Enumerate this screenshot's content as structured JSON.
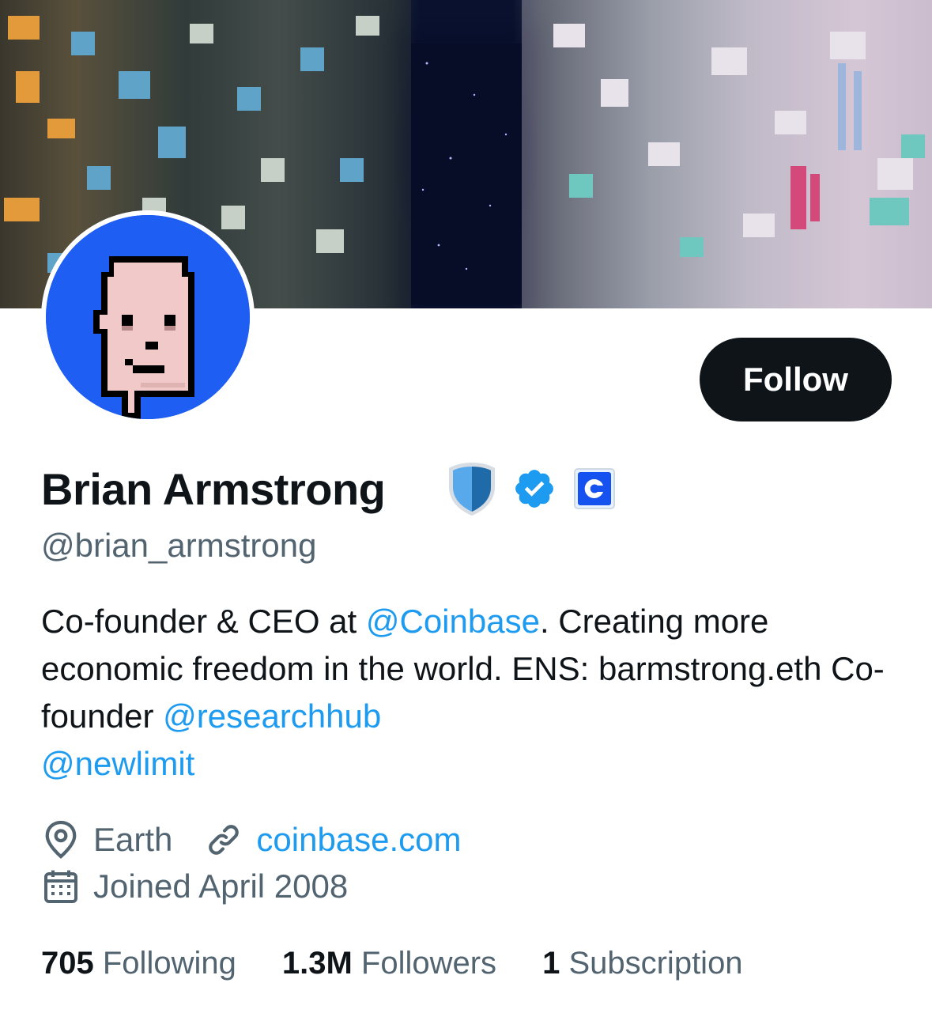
{
  "banner": {
    "description_icon": "city-courtyard-banner"
  },
  "profile": {
    "name": "Brian Armstrong",
    "handle": "@brian_armstrong",
    "follow_label": "Follow",
    "badges": [
      "shield-icon",
      "verified-badge-icon",
      "coinbase-affiliate-icon"
    ]
  },
  "bio": {
    "p1": "Co-founder & CEO at ",
    "mention1": "@Coinbase",
    "p2": ". Creating more economic freedom in the world. ENS: barmstrong.eth Co-founder ",
    "mention2": "@researchhub",
    "p3": " ",
    "mention3": "@newlimit"
  },
  "meta": {
    "location": "Earth",
    "website": "coinbase.com",
    "joined": "Joined April 2008"
  },
  "stats": {
    "following_count": "705",
    "following_label": "Following",
    "followers_count": "1.3M",
    "followers_label": "Followers",
    "subscriptions_count": "1",
    "subscriptions_label": "Subscription"
  },
  "colors": {
    "accent": "#1d9bf0",
    "text": "#0f1419",
    "muted": "#536471",
    "avatar_bg": "#1f5ef2",
    "button_bg": "#0f1419"
  }
}
